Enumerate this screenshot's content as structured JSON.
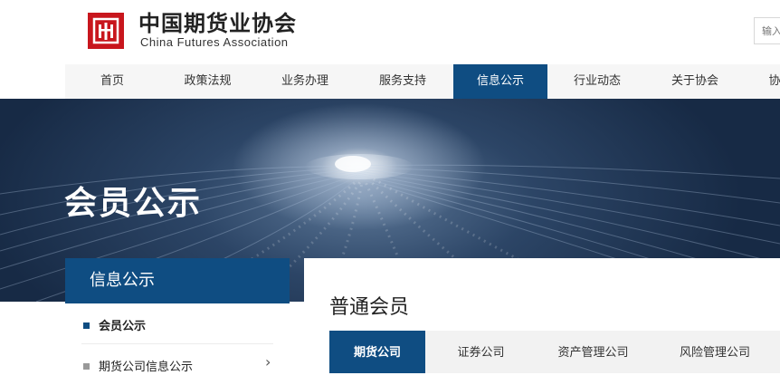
{
  "header": {
    "logo_cn": "中国期货业协会",
    "logo_en": "China Futures Association",
    "search_placeholder": "输入"
  },
  "nav": {
    "items": [
      {
        "label": "首页"
      },
      {
        "label": "政策法规"
      },
      {
        "label": "业务办理"
      },
      {
        "label": "服务支持"
      },
      {
        "label": "信息公示",
        "active": true
      },
      {
        "label": "行业动态"
      },
      {
        "label": "关于协会"
      },
      {
        "label": "协"
      }
    ]
  },
  "banner": {
    "title": "会员公示"
  },
  "sidebar": {
    "heading": "信息公示",
    "items": [
      {
        "label": "会员公示",
        "active": true
      },
      {
        "label": "期货公司信息公示",
        "has_submenu": true
      }
    ]
  },
  "main": {
    "title": "普通会员",
    "tabs": [
      {
        "label": "期货公司",
        "active": true
      },
      {
        "label": "证券公司"
      },
      {
        "label": "资产管理公司"
      },
      {
        "label": "风险管理公司"
      }
    ]
  },
  "colors": {
    "primary_blue": "#0f4d82",
    "logo_red": "#c8161d",
    "nav_bg": "#f6f6f6"
  }
}
